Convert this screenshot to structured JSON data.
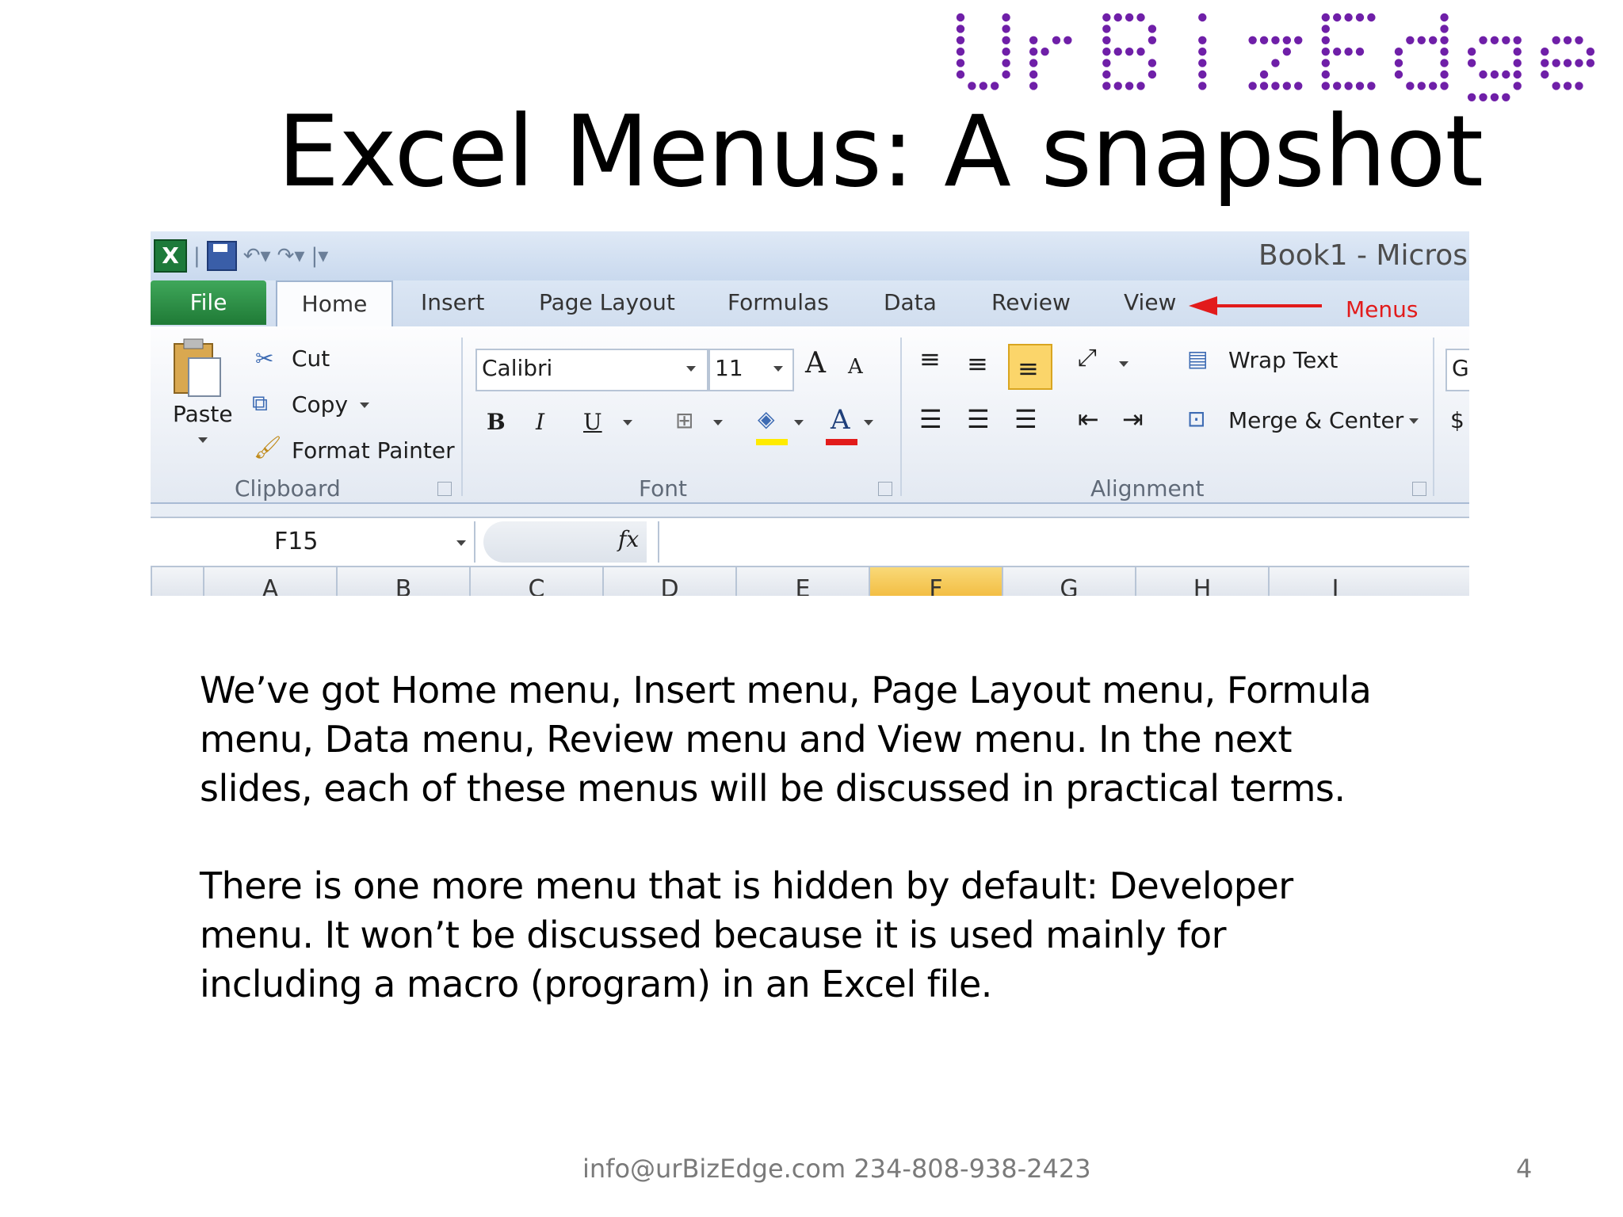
{
  "logo": {
    "text": "UrBizEdge",
    "color": "#6f1fa8"
  },
  "slide": {
    "title": "Excel Menus: A snapshot",
    "paragraph1": [
      "We’ve got Home menu, Insert menu, Page Layout menu, Formula",
      "menu, Data menu, Review menu and View menu. In the next",
      "slides, each of these menus will be discussed in practical terms."
    ],
    "paragraph2": [
      "There is one more menu that is hidden by default: Developer",
      "menu. It won’t be discussed because it is used mainly for",
      "including a macro (program) in an Excel file."
    ],
    "footer": "info@urBizEdge.com 234-808-938-2423",
    "page_number": "4"
  },
  "excel": {
    "window_title": "Book1 - Micros",
    "tabs": [
      "File",
      "Home",
      "Insert",
      "Page Layout",
      "Formulas",
      "Data",
      "Review",
      "View"
    ],
    "annotation": "Menus",
    "annotation_color": "#e21b1b",
    "clipboard": {
      "paste": "Paste",
      "cut": "Cut",
      "copy": "Copy",
      "format_painter": "Format Painter",
      "label": "Clipboard"
    },
    "font": {
      "name": "Calibri",
      "size": "11",
      "bold": "B",
      "italic": "I",
      "underline": "U",
      "grow": "A",
      "shrink": "A",
      "color_a": "A",
      "label": "Font"
    },
    "alignment": {
      "wrap_text": "Wrap Text",
      "merge_center": "Merge & Center",
      "label": "Alignment"
    },
    "cutoff_group": {
      "letter": "G",
      "letter2": "$"
    },
    "formula_bar": {
      "name_box": "F15",
      "fx": "fx"
    },
    "columns": [
      "A",
      "B",
      "C",
      "D",
      "E",
      "F",
      "G",
      "H",
      "I"
    ],
    "selected_column": "F"
  }
}
